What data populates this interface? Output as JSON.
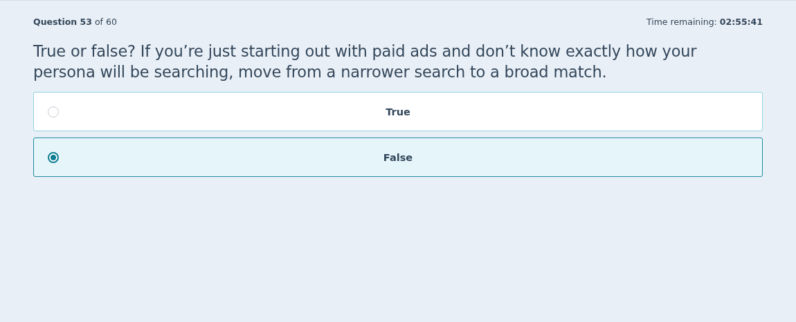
{
  "header": {
    "progress": "**Question 53** of 60",
    "timer": "Time remaining: **02:55:41**"
  },
  "question": "True or false? If you’re just starting out with paid ads and don’t know exactly how your persona will be searching, move from a narrower search to a broad match.",
  "options": [
    {
      "label": "True",
      "selected": false
    },
    {
      "label": "False",
      "selected": true
    }
  ]
}
